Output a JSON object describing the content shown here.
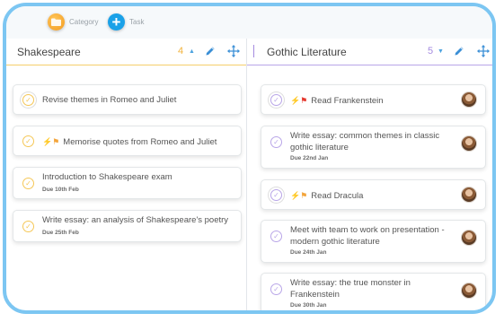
{
  "toolbar": {
    "category_label": "Category",
    "task_label": "Task",
    "task_glyph": "+"
  },
  "columns": [
    {
      "title": "Shakespeare",
      "count": "4",
      "sort_glyph": "▲",
      "accent": "#f5cf6b",
      "cards": [
        {
          "title": "Revise themes in Romeo and Juliet",
          "due": ""
        },
        {
          "title": "Memorise quotes from Romeo and Juliet",
          "due": "",
          "marks": [
            "bolt-red",
            "flag-orange"
          ]
        },
        {
          "title": "Introduction to Shakespeare exam",
          "due": "Due 10th Feb"
        },
        {
          "title": "Write essay: an analysis of Shakespeare's poetry",
          "due": "Due 25th Feb"
        }
      ]
    },
    {
      "title": "Gothic Literature",
      "count": "5",
      "sort_glyph": "▼",
      "accent": "#a58be0",
      "cards": [
        {
          "title": "Read Frankenstein",
          "due": "",
          "marks": [
            "bolt-red",
            "flag-red"
          ],
          "has_avatar": true
        },
        {
          "title_line1": "Write essay: common themes in classic",
          "title_line2": "gothic literature",
          "due": "Due 22nd Jan",
          "has_avatar": true
        },
        {
          "title": "Read Dracula",
          "due": "",
          "marks": [
            "bolt-orange",
            "flag-orange"
          ],
          "has_avatar": true
        },
        {
          "title_line1": "Meet with team to work on presentation -",
          "title_line2": "modern gothic literature",
          "due": "Due 24th Jan",
          "has_avatar": true
        },
        {
          "title_line1": "Write essay: the true monster in",
          "title_line2": "Frankenstein",
          "due": "Due 30th Jan",
          "has_avatar": true
        }
      ]
    }
  ],
  "colors": {
    "frame": "#7cc6f2",
    "yellow_check": "#f5c756",
    "purple_check": "#b9a6e8",
    "task_button": "#1aa1e8",
    "category_button": "#f39a1e"
  }
}
